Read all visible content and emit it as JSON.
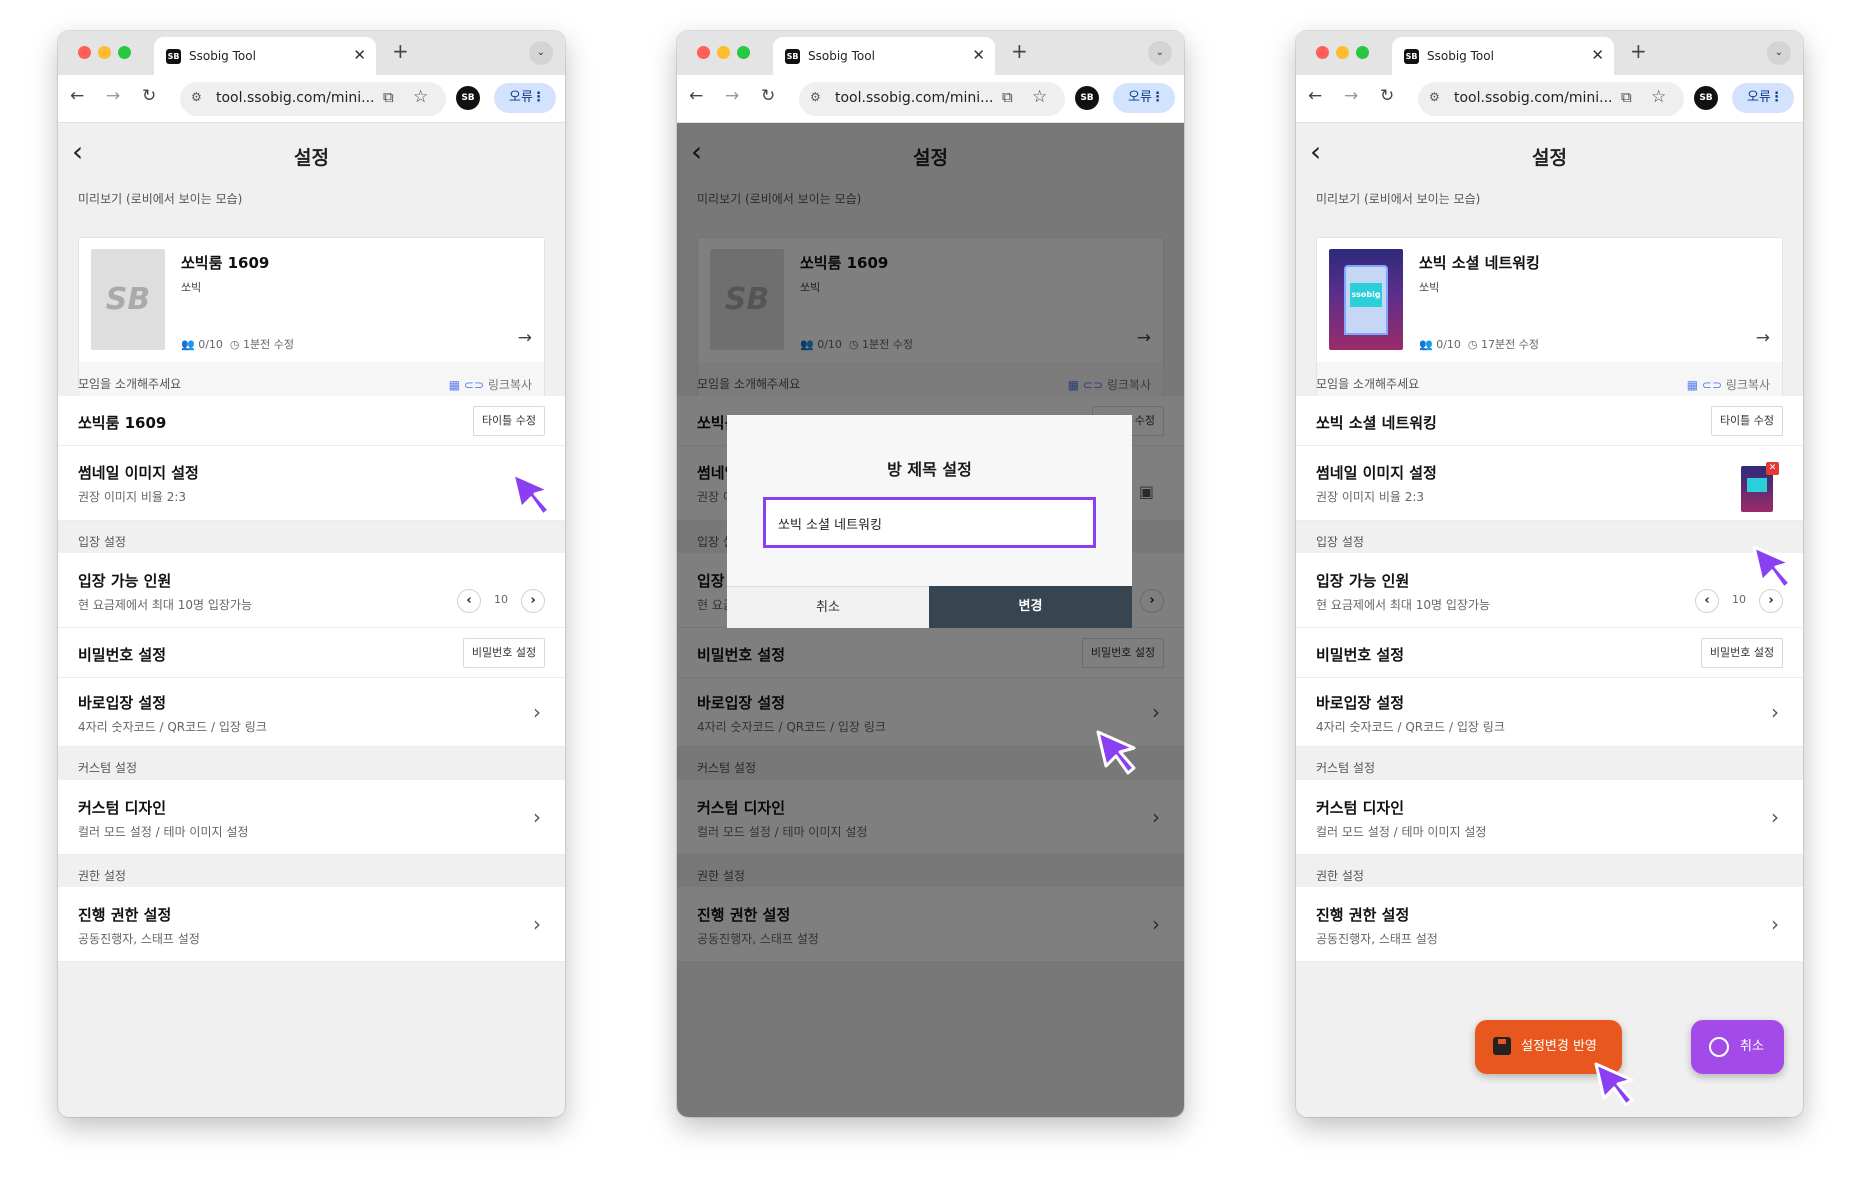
{
  "browser": {
    "tab_title": "Ssobig Tool",
    "url": "tool.ssobig.com/mini...",
    "error_label": "오류",
    "favicon": "SB"
  },
  "settings": {
    "title": "설정",
    "preview_label": "미리보기 (로비에서 보이는 모습)",
    "host": "쏘빅",
    "capacity": "0/10",
    "link_copy": "링크복사",
    "intro_label": "모임을 소개해주세요",
    "title_edit_btn": "타이틀 수정",
    "thumb_title": "썸네일 이미지 설정",
    "thumb_sub": "권장 이미지 비율 2:3",
    "entry_label": "입장 설정",
    "capacity_title": "입장 가능 인원",
    "capacity_sub": "현 요금제에서 최대 10명 입장가능",
    "capacity_value": "10",
    "password_title": "비밀번호 설정",
    "password_btn": "비밀번호 설정",
    "direct_title": "바로입장 설정",
    "direct_sub": "4자리 숫자코드 / QR코드 / 입장 링크",
    "custom_label": "커스텀 설정",
    "design_title": "커스텀 디자인",
    "design_sub": "컬러 모드 설정 / 테마 이미지 설정",
    "perm_label": "권한 설정",
    "perm_title": "진행 권한 설정",
    "perm_sub": "공동진행자, 스태프 설정"
  },
  "screens": [
    {
      "room_name": "쏘빅룸 1609",
      "updated": "1분전 수정"
    },
    {
      "room_name": "쏘빅룸 1609",
      "updated": "1분전 수정"
    },
    {
      "room_name": "쏘빅 소셜 네트워킹",
      "updated": "17분전 수정",
      "thumb_text": "ssobig"
    }
  ],
  "modal": {
    "title": "방 제목 설정",
    "input_value": "쏘빅 소셜 네트워킹",
    "cancel": "취소",
    "confirm": "변경"
  },
  "fab": {
    "save": "설정변경 반영",
    "cancel": "취소"
  },
  "colors": {
    "accent_purple": "#8b3ff2",
    "save_orange": "#e8571d",
    "cancel_purple": "#a24be8",
    "modal_button": "#36454f"
  },
  "icons": [
    "back-icon",
    "forward-icon",
    "reload-icon",
    "tune-icon",
    "share-icon",
    "star-icon",
    "qr-icon",
    "link-icon",
    "people-icon",
    "clock-icon",
    "arrow-right-icon",
    "image-icon",
    "chevron-right-icon",
    "cursor-icon",
    "save-icon",
    "cancel-icon"
  ]
}
